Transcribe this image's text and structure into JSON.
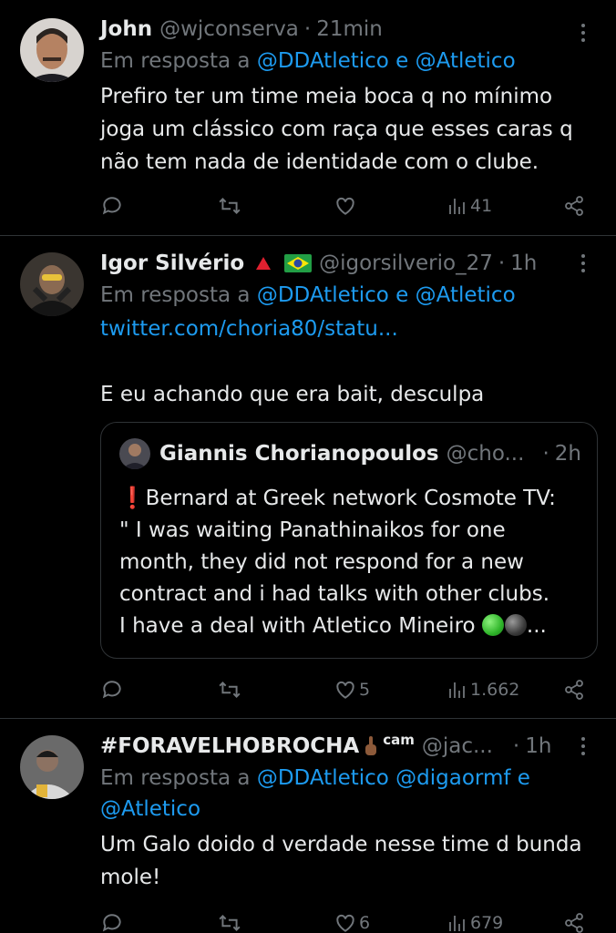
{
  "tweets": [
    {
      "name": "John",
      "handle": "@wjconserva",
      "dot": "·",
      "time": "21min",
      "reply_prefix": "Em resposta a",
      "reply_mentions": "@DDAtletico e @Atletico",
      "text_lines": [
        "Prefiro ter um time meia boca q no mínimo",
        "joga um clássico com raça que esses caras q",
        "não tem nada de identidade com o clube."
      ],
      "actions": {
        "replies": "",
        "retweets": "",
        "likes": "",
        "views": "41"
      }
    },
    {
      "name": "Igor Silvério",
      "handle": "@igorsilverio_27",
      "dot": "·",
      "time": "1h",
      "reply_prefix": "Em resposta a",
      "reply_mentions": "@DDAtletico e @Atletico",
      "link": "twitter.com/choria80/statu...",
      "text": "E eu achando que era bait, desculpa",
      "quote": {
        "name": "Giannis Chorianopoulos",
        "handle": "@cho...",
        "dot": "·",
        "time": "2h",
        "line1": "Bernard at Greek network Cosmote TV:",
        "line2": "\" I was waiting Panathinaikos for one",
        "line3": "month, they did not respond for a new",
        "line4": "contract and i had talks with other clubs.",
        "line5": "I have a deal with Atletico Mineiro",
        "ellipsis": "..."
      },
      "actions": {
        "replies": "",
        "retweets": "",
        "likes": "5",
        "views": "1.662"
      }
    },
    {
      "name": "#FORAVELHOBROCHA",
      "name_suffix": "cam",
      "handle": "@jac...",
      "dot": "·",
      "time": "1h",
      "reply_prefix": "Em resposta a",
      "reply_mentions_line1": "@DDAtletico @digaormf e",
      "reply_mentions_line2": "@Atletico",
      "text_lines": [
        "Um Galo doido d verdade nesse time d bunda",
        "mole!"
      ],
      "actions": {
        "replies": "",
        "retweets": "",
        "likes": "6",
        "views": "679"
      }
    }
  ],
  "icons": [
    "reply-icon",
    "retweet-icon",
    "like-icon",
    "views-icon",
    "share-icon",
    "more-icon",
    "warning-triangle-icon",
    "brazil-flag-icon",
    "hand-icon",
    "exclamation-icon"
  ],
  "colors": {
    "background": "#000000",
    "text": "#e7e9ea",
    "muted": "#71767b",
    "link": "#1d9bf0",
    "divider": "#2f3336",
    "green": "#34c924"
  }
}
